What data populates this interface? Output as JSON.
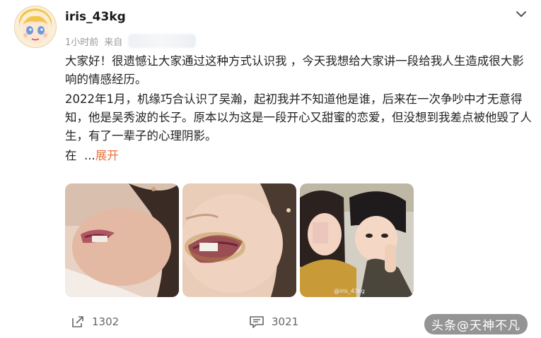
{
  "post": {
    "username": "iris_43kg",
    "time": "1小时前",
    "source_prefix": "来自",
    "paragraphs": [
      "大家好！很遗憾让大家通过这种方式认识我 ，今天我想给大家讲一段给我人生造成很大影响的情感经历。",
      "2022年1月，机缘巧合认识了吴瀚，起初我并不知道他是谁，后来在一次争吵中才无意得知，他是吴秀波的长子。原本以为这是一段开心又甜蜜的恋爱，但没想到我差点被他毁了人生，有了一辈子的心理阴影。"
    ],
    "truncated_text": "在",
    "ellipsis": "...",
    "expand_label": "展开",
    "photo3_watermark": "@iris_43kg"
  },
  "actions": {
    "repost_count": "1302",
    "comment_count": "3021"
  },
  "watermark": "头条@天神不凡",
  "icons": [
    "avatar",
    "chevron-down-icon",
    "repost-icon",
    "comment-icon"
  ],
  "colors": {
    "expand": "#eb7340",
    "meta": "#999999"
  }
}
